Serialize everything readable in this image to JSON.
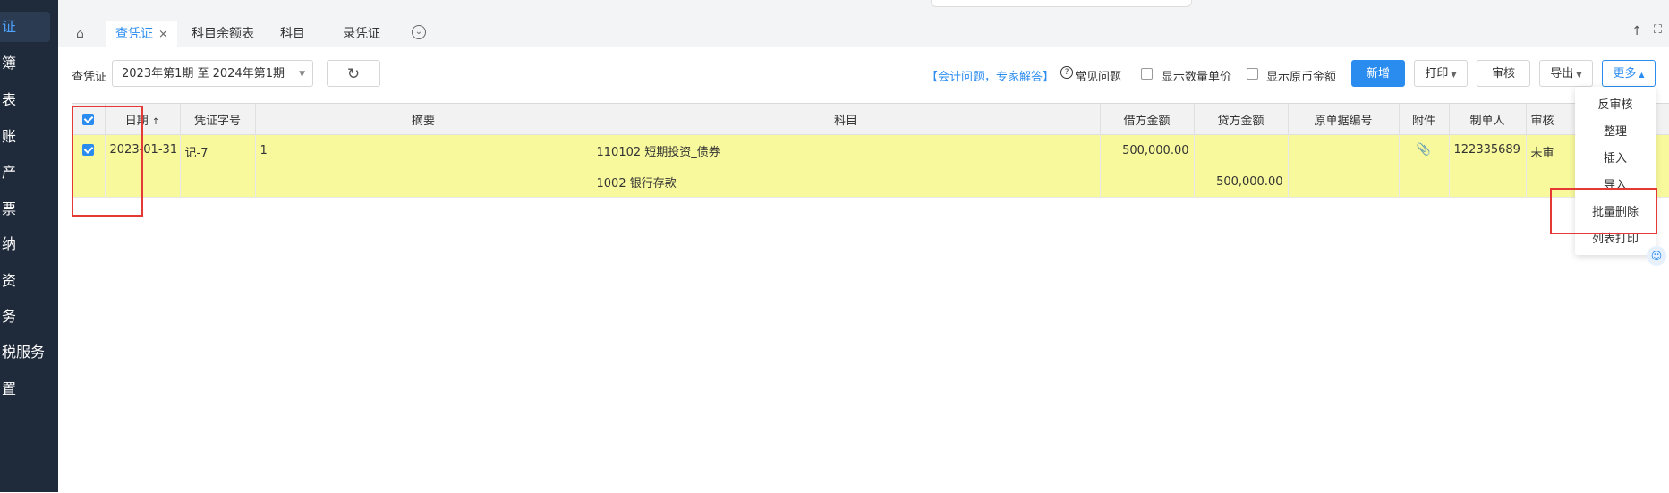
{
  "sidebar": {
    "items": [
      "证",
      "簿",
      "表",
      "账",
      "产",
      "票",
      "纳",
      "资",
      "务",
      "税服务",
      "置"
    ]
  },
  "tabs": {
    "home_icon": "home-icon",
    "items": [
      {
        "label": "查凭证",
        "close": "×"
      },
      {
        "label": "科目余额表"
      },
      {
        "label": "科目"
      },
      {
        "label": "录凭证"
      }
    ],
    "more_icon": "chevron-down-circle-icon",
    "right": [
      "↑",
      "⛶"
    ]
  },
  "toolbar": {
    "query_label": "查凭证",
    "period": "2023年第1期 至 2024年第1期",
    "refresh_icon": "refresh-icon",
    "consult_link": "【会计问题，专家解答】",
    "faq": "常见问题",
    "show_qty": "显示数量单价",
    "show_orig": "显示原币金额",
    "add": "新增",
    "print": "打印",
    "audit": "审核",
    "export": "导出",
    "more": "更多"
  },
  "table": {
    "headers": [
      "",
      "日期",
      "凭证字号",
      "摘要",
      "科目",
      "借方金额",
      "贷方金额",
      "原单据编号",
      "附件",
      "制单人",
      "审核"
    ],
    "rows": [
      {
        "date": "2023-01-31",
        "voucher": "记-7",
        "summary": "1",
        "account": "110102 短期投资_债券",
        "debit": "500,000.00",
        "credit": "",
        "orig": "",
        "attach": "📎",
        "maker": "122335689",
        "audit": "未审"
      },
      {
        "date": "",
        "voucher": "",
        "summary": "",
        "account": "1002 银行存款",
        "debit": "",
        "credit": "500,000.00",
        "orig": "",
        "attach": "",
        "maker": "",
        "audit": ""
      }
    ]
  },
  "more_menu": [
    "反审核",
    "整理",
    "插入",
    "导入",
    "批量删除",
    "列表打印"
  ],
  "colors": {
    "sidebar": "#1f2a3a",
    "accent": "#2b8cf0",
    "highlight_row": "#f8f99c",
    "annotation": "#e53935"
  }
}
